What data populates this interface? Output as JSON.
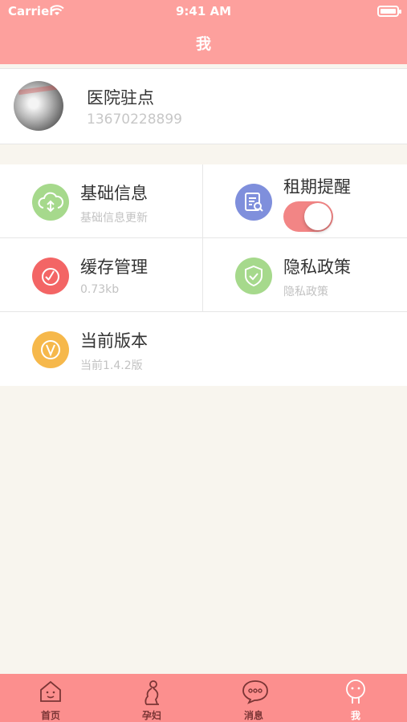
{
  "status": {
    "carrier": "Carrier",
    "time": "9:41 AM"
  },
  "nav": {
    "title": "我"
  },
  "profile": {
    "name": "医院驻点",
    "phone": "13670228899"
  },
  "menu": [
    {
      "title": "基础信息",
      "subtitle": "基础信息更新",
      "icon": "cloud-upload-icon",
      "color": "#a6d98c"
    },
    {
      "title": "租期提醒",
      "toggle_on": true,
      "icon": "search-document-icon",
      "color": "#7f8fdc"
    },
    {
      "title": "缓存管理",
      "subtitle": "0.73kb",
      "icon": "broom-icon",
      "color": "#f36565"
    },
    {
      "title": "隐私政策",
      "subtitle": "隐私政策",
      "icon": "shield-check-icon",
      "color": "#a6d98c"
    },
    {
      "title": "当前版本",
      "subtitle": "当前1.4.2版",
      "icon": "version-v-icon",
      "color": "#f6b84b"
    }
  ],
  "tabs": [
    {
      "label": "首页",
      "icon": "home-icon"
    },
    {
      "label": "孕妇",
      "icon": "pregnant-woman-icon"
    },
    {
      "label": "消息",
      "icon": "message-icon"
    },
    {
      "label": "我",
      "icon": "profile-face-icon",
      "active": true
    }
  ]
}
